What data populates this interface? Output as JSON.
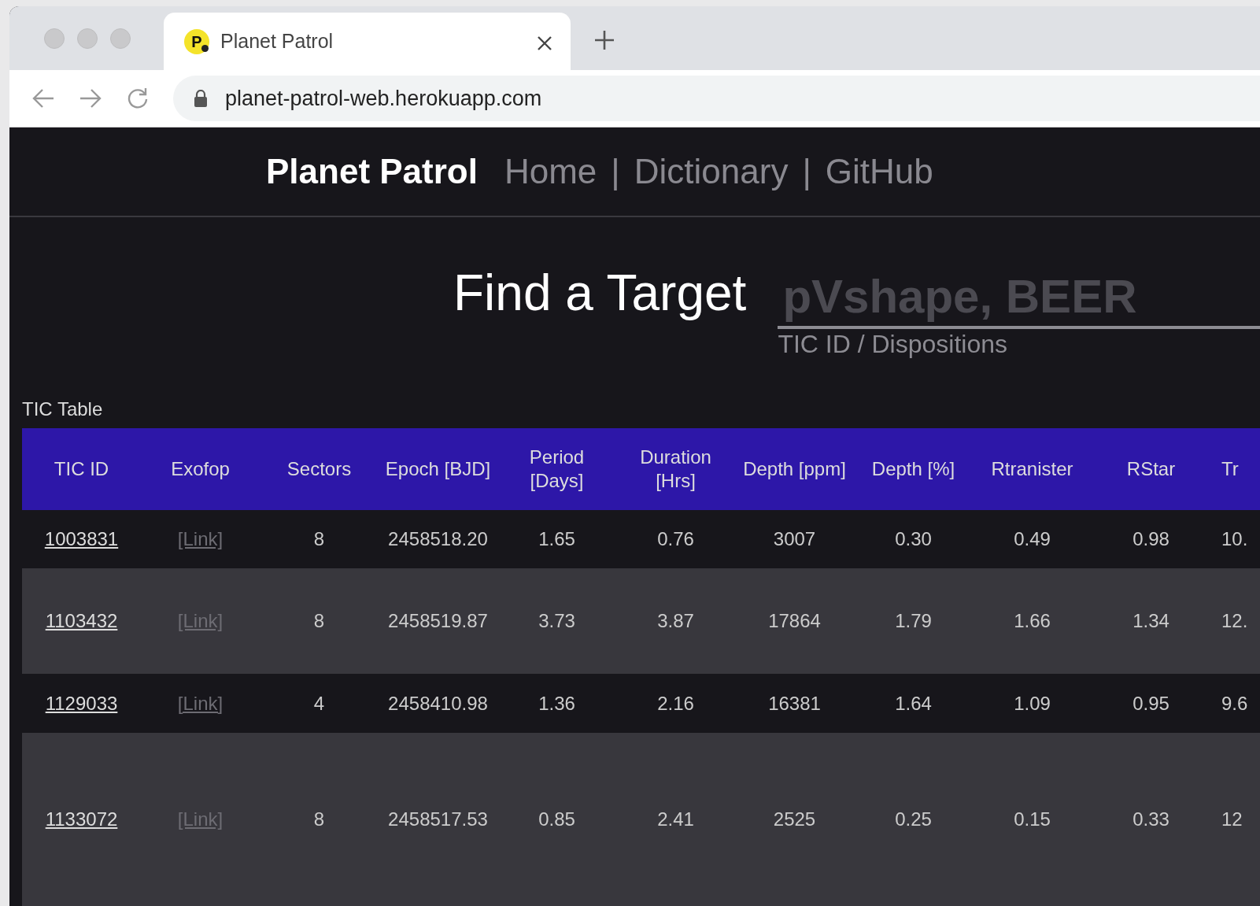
{
  "browser": {
    "tab": {
      "title": "Planet Patrol",
      "favicon_letter": "P"
    },
    "url": "planet-patrol-web.herokuapp.com"
  },
  "navbar": {
    "brand": "Planet Patrol",
    "links": [
      "Home",
      "Dictionary",
      "GitHub"
    ],
    "separators": [
      "|",
      "|"
    ]
  },
  "search": {
    "title": "Find a Target",
    "placeholder": "pVshape, BEER",
    "helper": "TIC ID / Dispositions"
  },
  "table": {
    "caption": "TIC Table",
    "columns": [
      {
        "label": "TIC ID",
        "kind": "link"
      },
      {
        "label": "Exofop",
        "kind": "muted-link"
      },
      {
        "label": "Sectors",
        "kind": "text"
      },
      {
        "label": "Epoch [BJD]",
        "kind": "text"
      },
      {
        "label": "Period [Days]",
        "kind": "text"
      },
      {
        "label": "Duration [Hrs]",
        "kind": "text"
      },
      {
        "label": "Depth [ppm]",
        "kind": "text"
      },
      {
        "label": "Depth [%]",
        "kind": "text"
      },
      {
        "label": "Rtranister",
        "kind": "text"
      },
      {
        "label": "RStar",
        "kind": "text"
      },
      {
        "label": "Tr",
        "kind": "text"
      }
    ],
    "rows": [
      [
        "1003831",
        "[Link]",
        "8",
        "2458518.20",
        "1.65",
        "0.76",
        "3007",
        "0.30",
        "0.49",
        "0.98",
        "10."
      ],
      [
        "1103432",
        "[Link]",
        "8",
        "2458519.87",
        "3.73",
        "3.87",
        "17864",
        "1.79",
        "1.66",
        "1.34",
        "12."
      ],
      [
        "1129033",
        "[Link]",
        "4",
        "2458410.98",
        "1.36",
        "2.16",
        "16381",
        "1.64",
        "1.09",
        "0.95",
        "9.6"
      ],
      [
        "1133072",
        "[Link]",
        "8",
        "2458517.53",
        "0.85",
        "2.41",
        "2525",
        "0.25",
        "0.15",
        "0.33",
        "12"
      ]
    ]
  }
}
